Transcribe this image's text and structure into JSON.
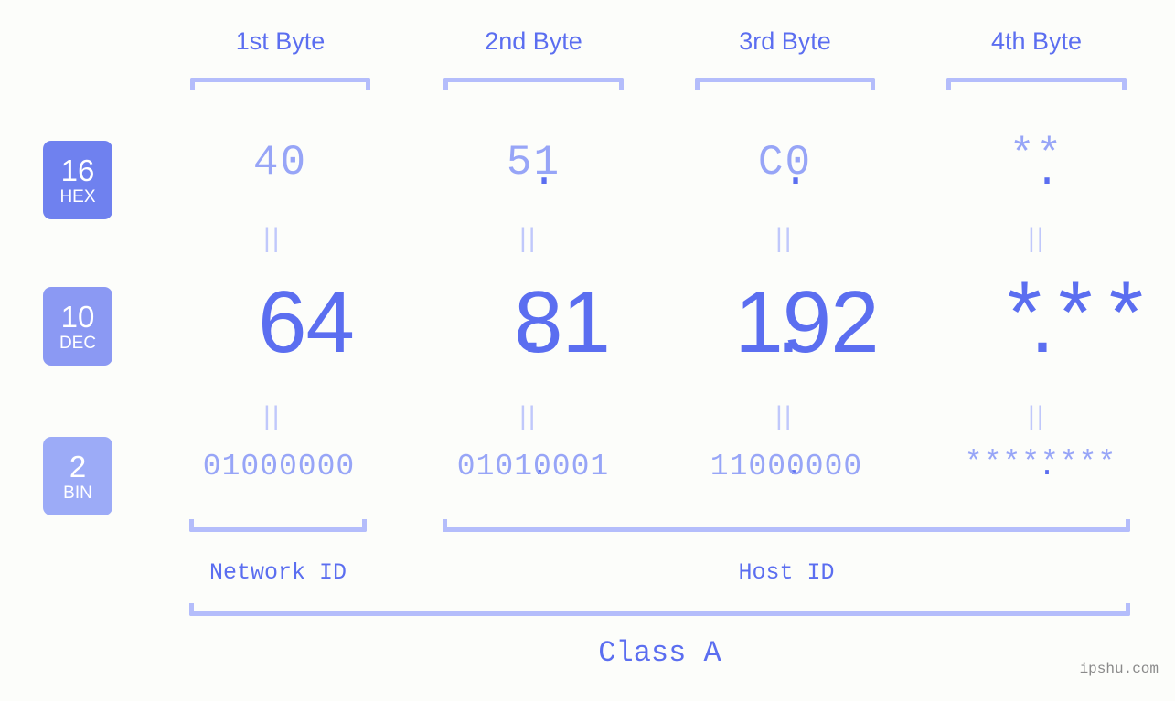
{
  "page": {
    "background_color": "#fcfdfa",
    "accent_color": "#5b6ef0",
    "muted_accent_color": "#97a5f7",
    "bracket_color": "#b4bdfb",
    "watermark": "ipshu.com"
  },
  "byte_headers": [
    {
      "label": "1st Byte"
    },
    {
      "label": "2nd Byte"
    },
    {
      "label": "3rd Byte"
    },
    {
      "label": "4th Byte"
    }
  ],
  "bases": [
    {
      "number": "16",
      "abbr": "HEX",
      "color": "#6f81ef"
    },
    {
      "number": "10",
      "abbr": "DEC",
      "color": "#8b99f3"
    },
    {
      "number": "2",
      "abbr": "BIN",
      "color": "#9cabf7"
    }
  ],
  "rows": {
    "hex": {
      "base_number": "16",
      "base_abbr": "HEX",
      "values": [
        "40",
        "51",
        "C0",
        "**"
      ],
      "separator": "."
    },
    "dec": {
      "base_number": "10",
      "base_abbr": "DEC",
      "values": [
        "64",
        "81",
        "192",
        "***"
      ],
      "separator": "."
    },
    "bin": {
      "base_number": "2",
      "base_abbr": "BIN",
      "values": [
        "01000000",
        "01010001",
        "11000000",
        "********"
      ],
      "separator": "."
    }
  },
  "equality_marks": {
    "glyph": "||",
    "count_per_gap": 4
  },
  "segments": {
    "network_id": "Network ID",
    "host_id": "Host ID",
    "class": "Class A"
  }
}
